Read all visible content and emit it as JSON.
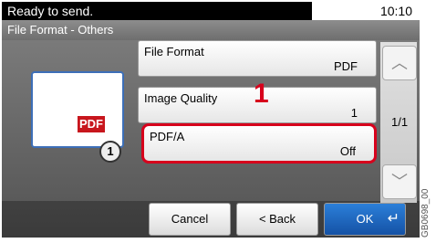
{
  "status": {
    "message": "Ready to send.",
    "time": "10:10"
  },
  "screen_title": "File Format - Others",
  "settings": [
    {
      "label": "File Format",
      "value": "PDF"
    },
    {
      "label": "Image Quality",
      "value": "1"
    },
    {
      "label": "PDF/A",
      "value": "Off"
    }
  ],
  "preview": {
    "badge": "PDF",
    "number": "1"
  },
  "annotation_number": "1",
  "page_indicator": "1/1",
  "buttons": {
    "cancel": "Cancel",
    "back": "< Back",
    "ok": "OK"
  },
  "image_code": "GB0698_00",
  "colors": {
    "highlight": "#d7001c",
    "ok_button": "#1552a5",
    "pdf_badge": "#c8161d"
  }
}
